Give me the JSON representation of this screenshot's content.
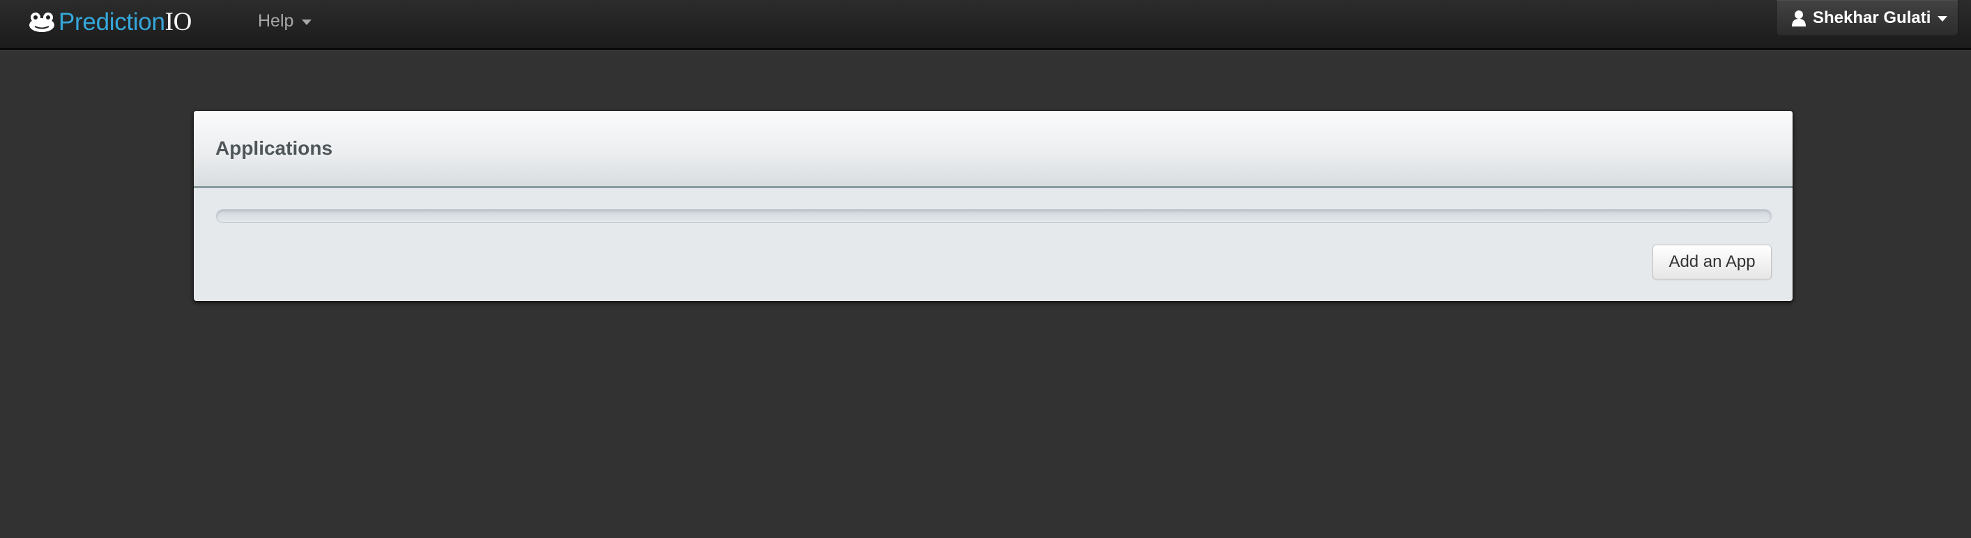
{
  "navbar": {
    "brand": {
      "part1": "Prediction",
      "part2": "IO",
      "icon": "frog-logo-icon"
    },
    "help_menu": {
      "label": "Help",
      "icon": "caret-down-icon"
    },
    "user_menu": {
      "label": "Shekhar Gulati",
      "icon": "user-icon"
    }
  },
  "panel": {
    "title": "Applications",
    "progress": 0,
    "add_button_label": "Add an App"
  },
  "colors": {
    "brand_blue": "#35a8dc",
    "background": "#323232",
    "navbar": "#1f1f1f"
  }
}
